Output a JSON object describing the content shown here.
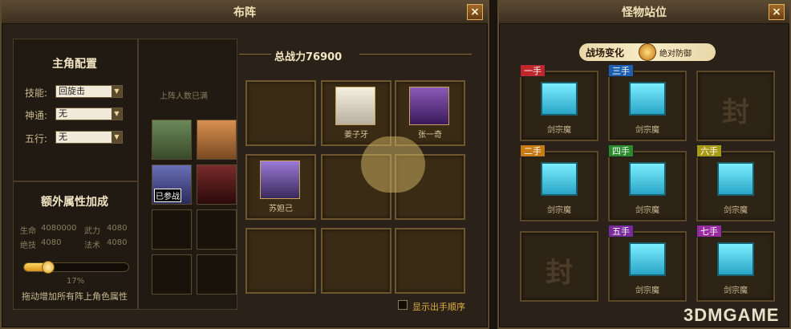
{
  "left_panel": {
    "title": "布阵",
    "close_label": "×",
    "config": {
      "heading": "主角配置",
      "rows": [
        {
          "label": "技能:",
          "value": "回旋击"
        },
        {
          "label": "神通:",
          "value": "无"
        },
        {
          "label": "五行:",
          "value": "无"
        }
      ]
    },
    "extra": {
      "heading": "额外属性加成",
      "stats": [
        {
          "label": "生命",
          "value": "4080000"
        },
        {
          "label": "武力",
          "value": "4080"
        },
        {
          "label": "绝技",
          "value": "4080"
        },
        {
          "label": "法术",
          "value": "4080"
        }
      ],
      "slider_percent": 17,
      "slider_label": "17%",
      "hint": "拖动增加所有阵上角色属性"
    },
    "full_notice": "上阵人数已满",
    "bench_badge": "已参战",
    "total_power": "总战力76900",
    "formation": [
      {
        "name": ""
      },
      {
        "name": "姜子牙"
      },
      {
        "name": "张一奇"
      },
      {
        "name": "苏妲己"
      },
      {
        "name": ""
      },
      {
        "name": ""
      },
      {
        "name": ""
      },
      {
        "name": ""
      },
      {
        "name": ""
      }
    ],
    "show_order_label": "显示出手顺序"
  },
  "right_panel": {
    "title": "怪物站位",
    "close_label": "×",
    "battle_change": "战场变化",
    "battle_change_value": "绝对防御",
    "slots": [
      {
        "tag": "一手",
        "tag_color": "#c0272d",
        "name": "剑宗魔",
        "sealed": false
      },
      {
        "tag": "三手",
        "tag_color": "#1e5fb0",
        "name": "剑宗魔",
        "sealed": false
      },
      {
        "tag": "",
        "tag_color": "",
        "name": "",
        "sealed": true
      },
      {
        "tag": "二手",
        "tag_color": "#c77a12",
        "name": "剑宗魔",
        "sealed": false
      },
      {
        "tag": "四手",
        "tag_color": "#2b8a2b",
        "name": "剑宗魔",
        "sealed": false
      },
      {
        "tag": "六手",
        "tag_color": "#a89a12",
        "name": "剑宗魔",
        "sealed": false
      },
      {
        "tag": "",
        "tag_color": "",
        "name": "",
        "sealed": true
      },
      {
        "tag": "五手",
        "tag_color": "#7a2a9a",
        "name": "剑宗魔",
        "sealed": false
      },
      {
        "tag": "七手",
        "tag_color": "#9a2aa0",
        "name": "剑宗魔",
        "sealed": false
      }
    ],
    "seal_char": "封"
  },
  "watermark": "3DMGAME"
}
